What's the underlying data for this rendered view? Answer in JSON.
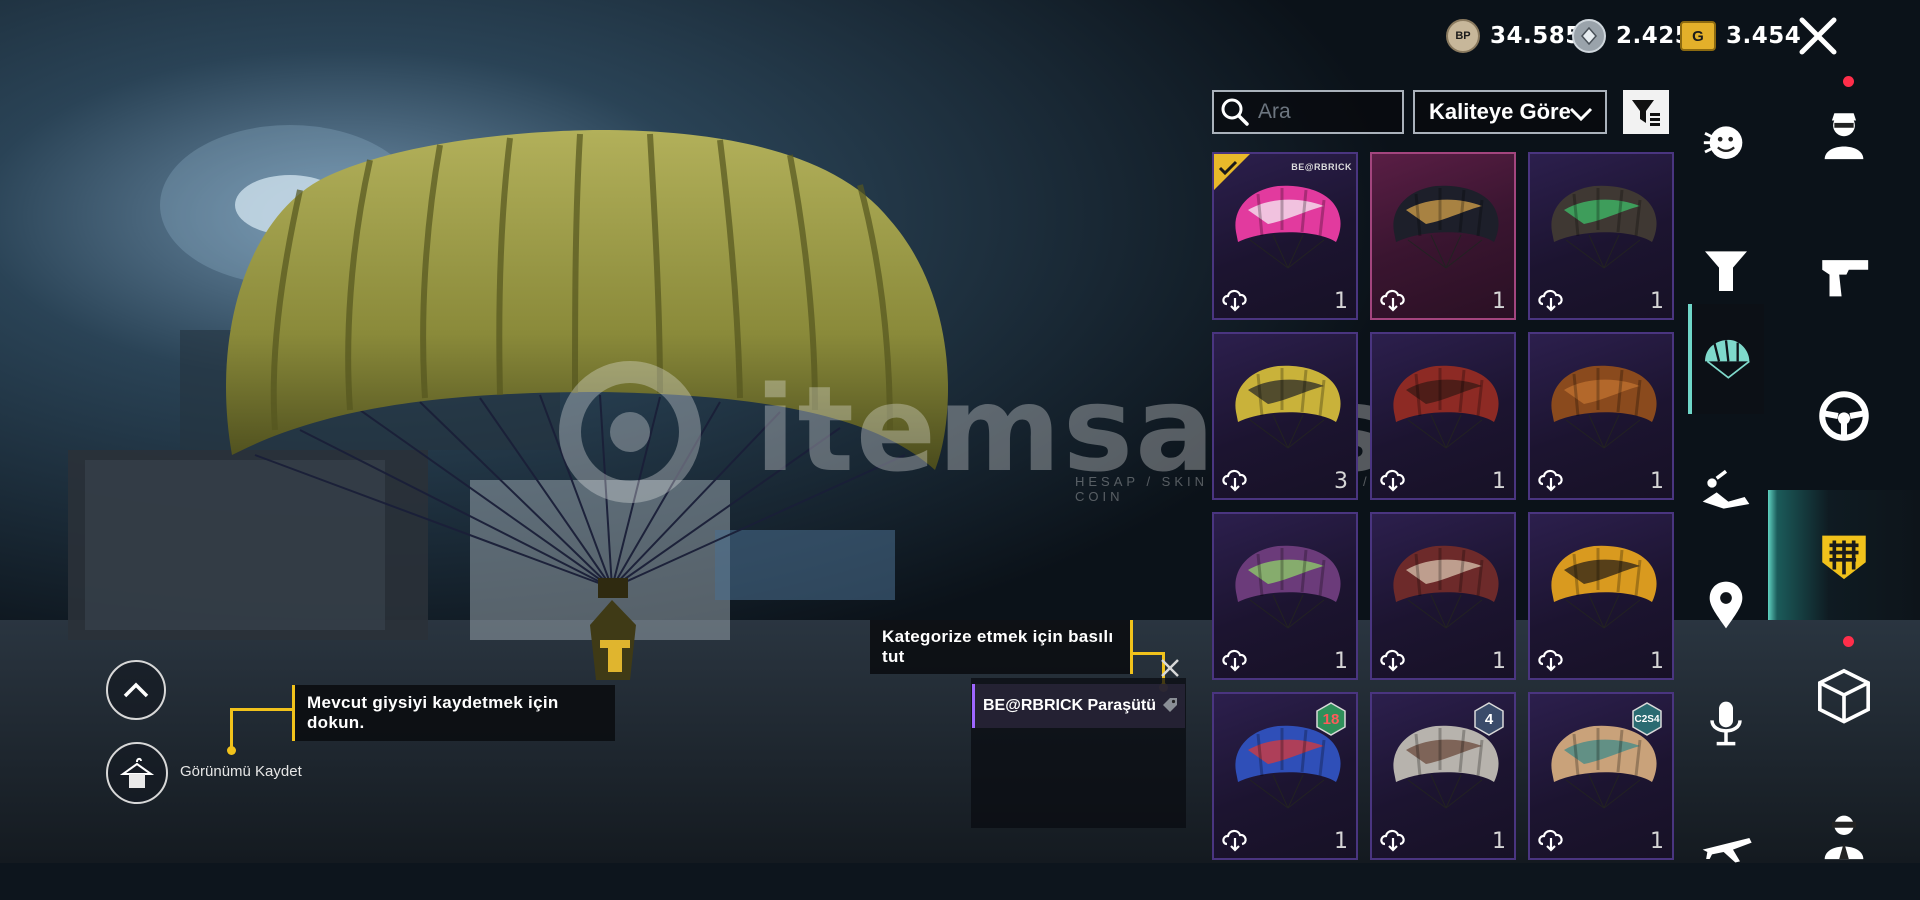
{
  "currencies": [
    {
      "icon": "bp-coin-icon",
      "symbol": "BP",
      "value": "34.585"
    },
    {
      "icon": "silver-fragment-icon",
      "symbol": "",
      "value": "2.425"
    },
    {
      "icon": "gold-g-coin-icon",
      "symbol": "G",
      "value": "3.454"
    }
  ],
  "toolbar": {
    "search_placeholder": "Ara",
    "sort_label": "Kaliteye Göre"
  },
  "items": [
    {
      "name": "pink graffiti parachute",
      "count": "1",
      "selected": false,
      "equipped": true,
      "brand": "BE@RBRICK",
      "colors": [
        "#e23a9e",
        "#f5f0f4"
      ]
    },
    {
      "name": "black mandala parachute",
      "count": "1",
      "selected": true,
      "colors": [
        "#1d1f2a",
        "#d7a44b"
      ]
    },
    {
      "name": "dark camo parachute",
      "count": "1",
      "colors": [
        "#3f3833",
        "#3fbf6a"
      ]
    },
    {
      "name": "yellow smiley parachute",
      "count": "3",
      "colors": [
        "#c9b23a",
        "#2a2a2a"
      ]
    },
    {
      "name": "red dragon parachute",
      "count": "1",
      "colors": [
        "#8d2a24",
        "#3a1a14"
      ]
    },
    {
      "name": "brown leopard parachute",
      "count": "1",
      "colors": [
        "#8a4a1d",
        "#c07330"
      ]
    },
    {
      "name": "purple green graffiti parachute",
      "count": "1",
      "colors": [
        "#6b3b7a",
        "#8fd36a"
      ]
    },
    {
      "name": "red letter parachute",
      "count": "1",
      "colors": [
        "#6d2a2a",
        "#d9c6b0"
      ]
    },
    {
      "name": "yellow black floral parachute",
      "count": "1",
      "colors": [
        "#d99a1f",
        "#2a2018"
      ]
    },
    {
      "name": "blue red circus parachute",
      "count": "1",
      "badge": "18",
      "colors": [
        "#2f4fb8",
        "#d93a3a"
      ]
    },
    {
      "name": "white skull parachute",
      "count": "1",
      "badge": "4",
      "colors": [
        "#b7b3ad",
        "#6b4a3c"
      ]
    },
    {
      "name": "teal brown comic parachute",
      "count": "1",
      "badge": "C2S4",
      "colors": [
        "#c9a27a",
        "#3f8a8a"
      ]
    }
  ],
  "side_tabs_a": [
    {
      "icon": "emote-icon"
    },
    {
      "icon": "slingshot-icon"
    },
    {
      "icon": "parachute-icon",
      "active": true
    },
    {
      "icon": "fallen-pose-icon"
    },
    {
      "icon": "location-pin-icon"
    },
    {
      "icon": "microphone-icon"
    },
    {
      "icon": "airplane-icon"
    }
  ],
  "side_tabs_b": [
    {
      "icon": "character-icon",
      "dot": true
    },
    {
      "icon": "pistol-icon"
    },
    {
      "icon": "steering-wheel-icon"
    },
    {
      "icon": "vehicle-badge-icon",
      "active": true
    },
    {
      "icon": "crate-icon",
      "dot": true
    },
    {
      "icon": "agent-icon"
    }
  ],
  "tooltips": {
    "categorize": "Kategorize etmek için basılı tut",
    "save_outfit": "Mevcut giysiyi kaydetmek için dokun."
  },
  "equipped_item_name": "BE@RBRICK Paraşütü",
  "save_look_label": "Görünümü Kaydet",
  "watermark": {
    "text": "itemsatis",
    "subtitle": "HESAP / SKIN / ITEM / E-PIN / COIN"
  },
  "colors": {
    "accent_teal": "#6fd6c8",
    "tooltip_yellow": "#f1c21b",
    "rarity_purple": "#4a3580",
    "selected_pink": "#a3457e"
  }
}
